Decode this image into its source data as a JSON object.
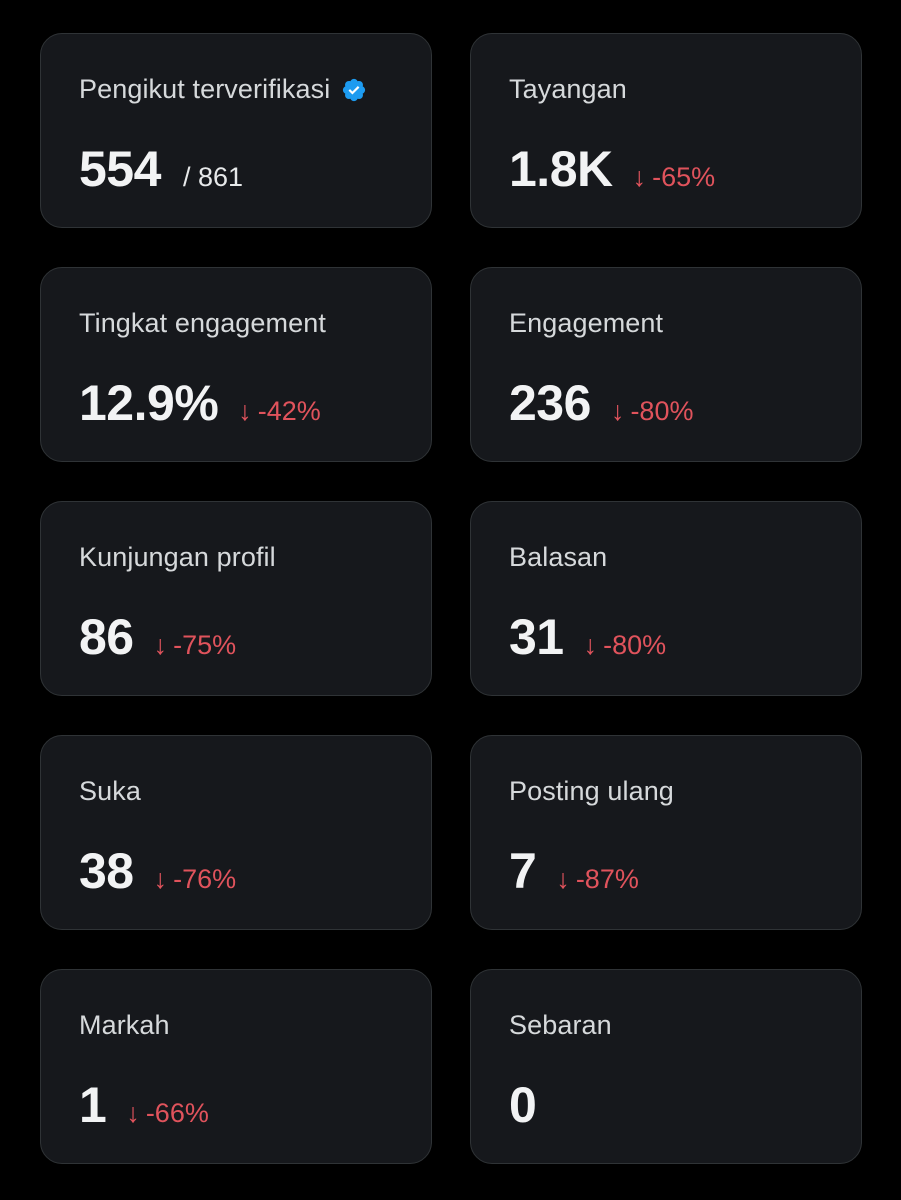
{
  "cards": [
    {
      "label": "Pengikut terverifikasi",
      "value": "554",
      "total": "/ 861",
      "change": "",
      "verified_icon": "verified-badge-icon"
    },
    {
      "label": "Tayangan",
      "value": "1.8K",
      "change": "-65%"
    },
    {
      "label": "Tingkat engagement",
      "value": "12.9%",
      "change": "-42%"
    },
    {
      "label": "Engagement",
      "value": "236",
      "change": "-80%"
    },
    {
      "label": "Kunjungan profil",
      "value": "86",
      "change": "-75%"
    },
    {
      "label": "Balasan",
      "value": "31",
      "change": "-80%"
    },
    {
      "label": "Suka",
      "value": "38",
      "change": "-76%"
    },
    {
      "label": "Posting ulang",
      "value": "7",
      "change": "-87%"
    },
    {
      "label": "Markah",
      "value": "1",
      "change": "-66%"
    },
    {
      "label": "Sebaran",
      "value": "0",
      "change": ""
    }
  ],
  "colors": {
    "background": "#000000",
    "card_background": "#16181c",
    "card_border": "#2f3336",
    "negative_change": "#e0535c",
    "verified_badge": "#1d9bf0"
  },
  "icons": {
    "change_arrow": "arrow-down-icon",
    "change_arrow_glyph": "↓"
  }
}
